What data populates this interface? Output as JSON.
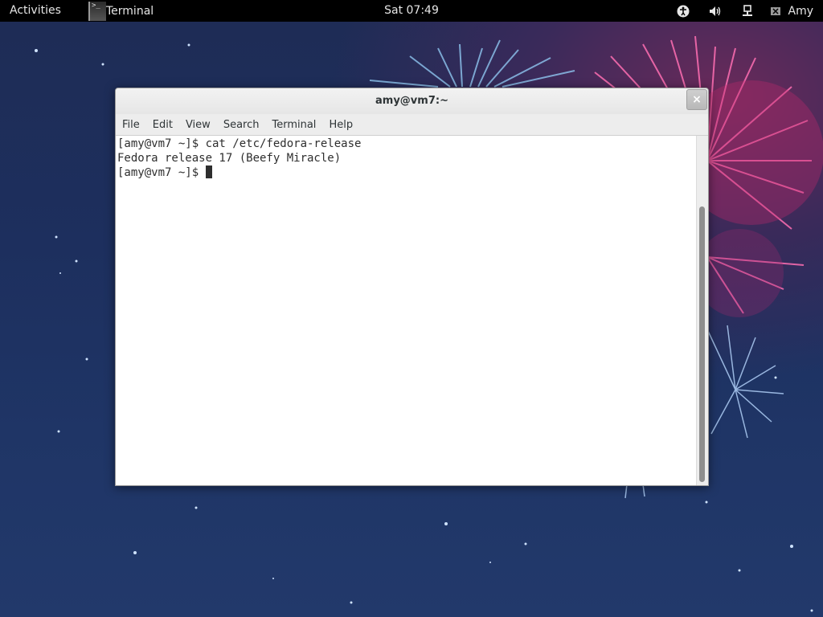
{
  "topbar": {
    "activities_label": "Activities",
    "app_label": "Terminal",
    "clock": "Sat 07:49",
    "user_label": "Amy",
    "icons": [
      "accessibility-icon",
      "volume-icon",
      "network-icon",
      "user-status-icon"
    ]
  },
  "window": {
    "title": "amy@vm7:~",
    "close_label": "×",
    "menu": {
      "file": "File",
      "edit": "Edit",
      "view": "View",
      "search": "Search",
      "terminal": "Terminal",
      "help": "Help"
    },
    "lines": {
      "line1": "[amy@vm7 ~]$ cat /etc/fedora-release",
      "line2": "Fedora release 17 (Beefy Miracle)",
      "prompt": "[amy@vm7 ~]$ "
    }
  },
  "colors": {
    "topbar_bg": "#000000",
    "desktop_bg": "#1e2c55",
    "window_bg": "#ffffff"
  }
}
